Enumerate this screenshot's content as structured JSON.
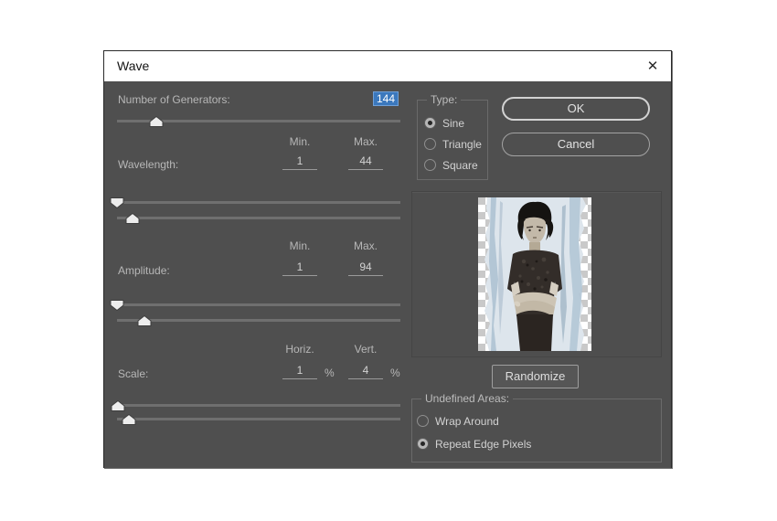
{
  "window": {
    "title": "Wave",
    "close_icon": "✕"
  },
  "generators": {
    "label": "Number of Generators:",
    "value": "144"
  },
  "wavelength": {
    "label": "Wavelength:",
    "min_header": "Min.",
    "max_header": "Max.",
    "min_value": "1",
    "max_value": "44"
  },
  "amplitude": {
    "label": "Amplitude:",
    "min_header": "Min.",
    "max_header": "Max.",
    "min_value": "1",
    "max_value": "94"
  },
  "scale": {
    "label": "Scale:",
    "horiz_header": "Horiz.",
    "vert_header": "Vert.",
    "horiz_value": "1",
    "vert_value": "4",
    "horiz_unit": "%",
    "vert_unit": "%"
  },
  "type_group": {
    "label": "Type:",
    "options": [
      {
        "label": "Sine",
        "selected": true
      },
      {
        "label": "Triangle",
        "selected": false
      },
      {
        "label": "Square",
        "selected": false
      }
    ]
  },
  "buttons": {
    "ok": "OK",
    "cancel": "Cancel",
    "randomize": "Randomize"
  },
  "undefined_areas": {
    "label": "Undefined Areas:",
    "options": [
      {
        "label": "Wrap Around",
        "selected": false
      },
      {
        "label": "Repeat Edge Pixels",
        "selected": true
      }
    ]
  },
  "sliders": {
    "generators_pos": "13.9%",
    "wavelength_min_pos": "0%",
    "wavelength_max_pos": "5.5%",
    "amplitude_min_pos": "0%",
    "amplitude_max_pos": "9.7%",
    "scale_horiz_pos": "0.3%",
    "scale_vert_pos": "4.2%"
  },
  "colors": {
    "dialog_bg": "#4f4f4f",
    "titlebar_bg": "#ffffff",
    "selection_blue": "#3b78bd",
    "label_text": "#b7b7b7",
    "value_text": "#d2d2d2"
  }
}
